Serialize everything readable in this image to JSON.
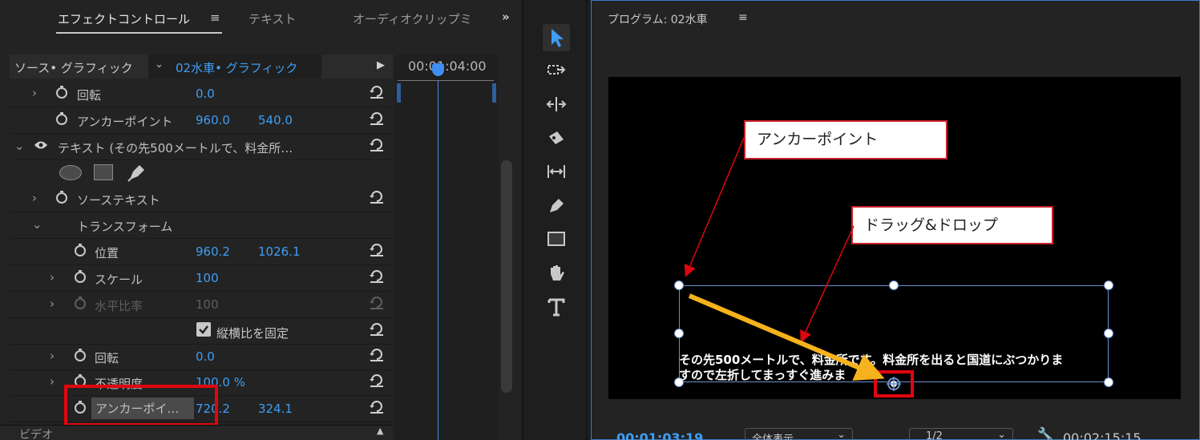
{
  "effect_controls": {
    "tabs": [
      {
        "label": "エフェクトコントロール"
      },
      {
        "label": "テキスト"
      },
      {
        "label": "オーディオクリップミ"
      }
    ],
    "tab_menu_glyph": "≡",
    "more_glyph": "»",
    "source_label": "ソース• グラフィック",
    "clip_label": "02水車• グラフィック",
    "timecode": "00:01:04:00",
    "rows": {
      "rotation1": {
        "label": "回転",
        "value": "0.0"
      },
      "anchor1": {
        "label": "アンカーポイント",
        "x": "960.0",
        "y": "540.0"
      },
      "text_layer": {
        "label": "テキスト (その先500メートルで、料金所…"
      },
      "source_text": {
        "label": "ソーステキスト"
      },
      "transform": {
        "label": "トランスフォーム"
      },
      "position": {
        "label": "位置",
        "x": "960.2",
        "y": "1026.1"
      },
      "scale": {
        "label": "スケール",
        "value": "100"
      },
      "scale_width": {
        "label": "水平比率",
        "value": "100"
      },
      "uniform_scale": {
        "label": "縦横比を固定",
        "checked": true
      },
      "rotation2": {
        "label": "回転",
        "value": "0.0"
      },
      "opacity": {
        "label": "不透明度",
        "value": "100.0 %"
      },
      "anchor2": {
        "label": "アンカーポイ…",
        "x": "720.2",
        "y": "324.1"
      }
    },
    "video_section": "ビデオ"
  },
  "program_monitor": {
    "title": "プログラム: 02水車",
    "menu_glyph": "≡",
    "caption_line1": "その先500メートルで、料金所です。料金所を出ると国道にぶつかりま",
    "caption_line2": "すので左折してまっすぐ進みま",
    "current_timecode": "00:01:03:19",
    "zoom": "全体表示",
    "resolution": "1/2",
    "duration": "00:02:15:15"
  },
  "callouts": {
    "anchor": "アンカーポイント",
    "drag": "ドラッグ&ドロップ"
  },
  "colors": {
    "accent_blue": "#3f9ef5",
    "highlight_red": "#e0060f",
    "drag_arrow": "#f5b21c"
  }
}
